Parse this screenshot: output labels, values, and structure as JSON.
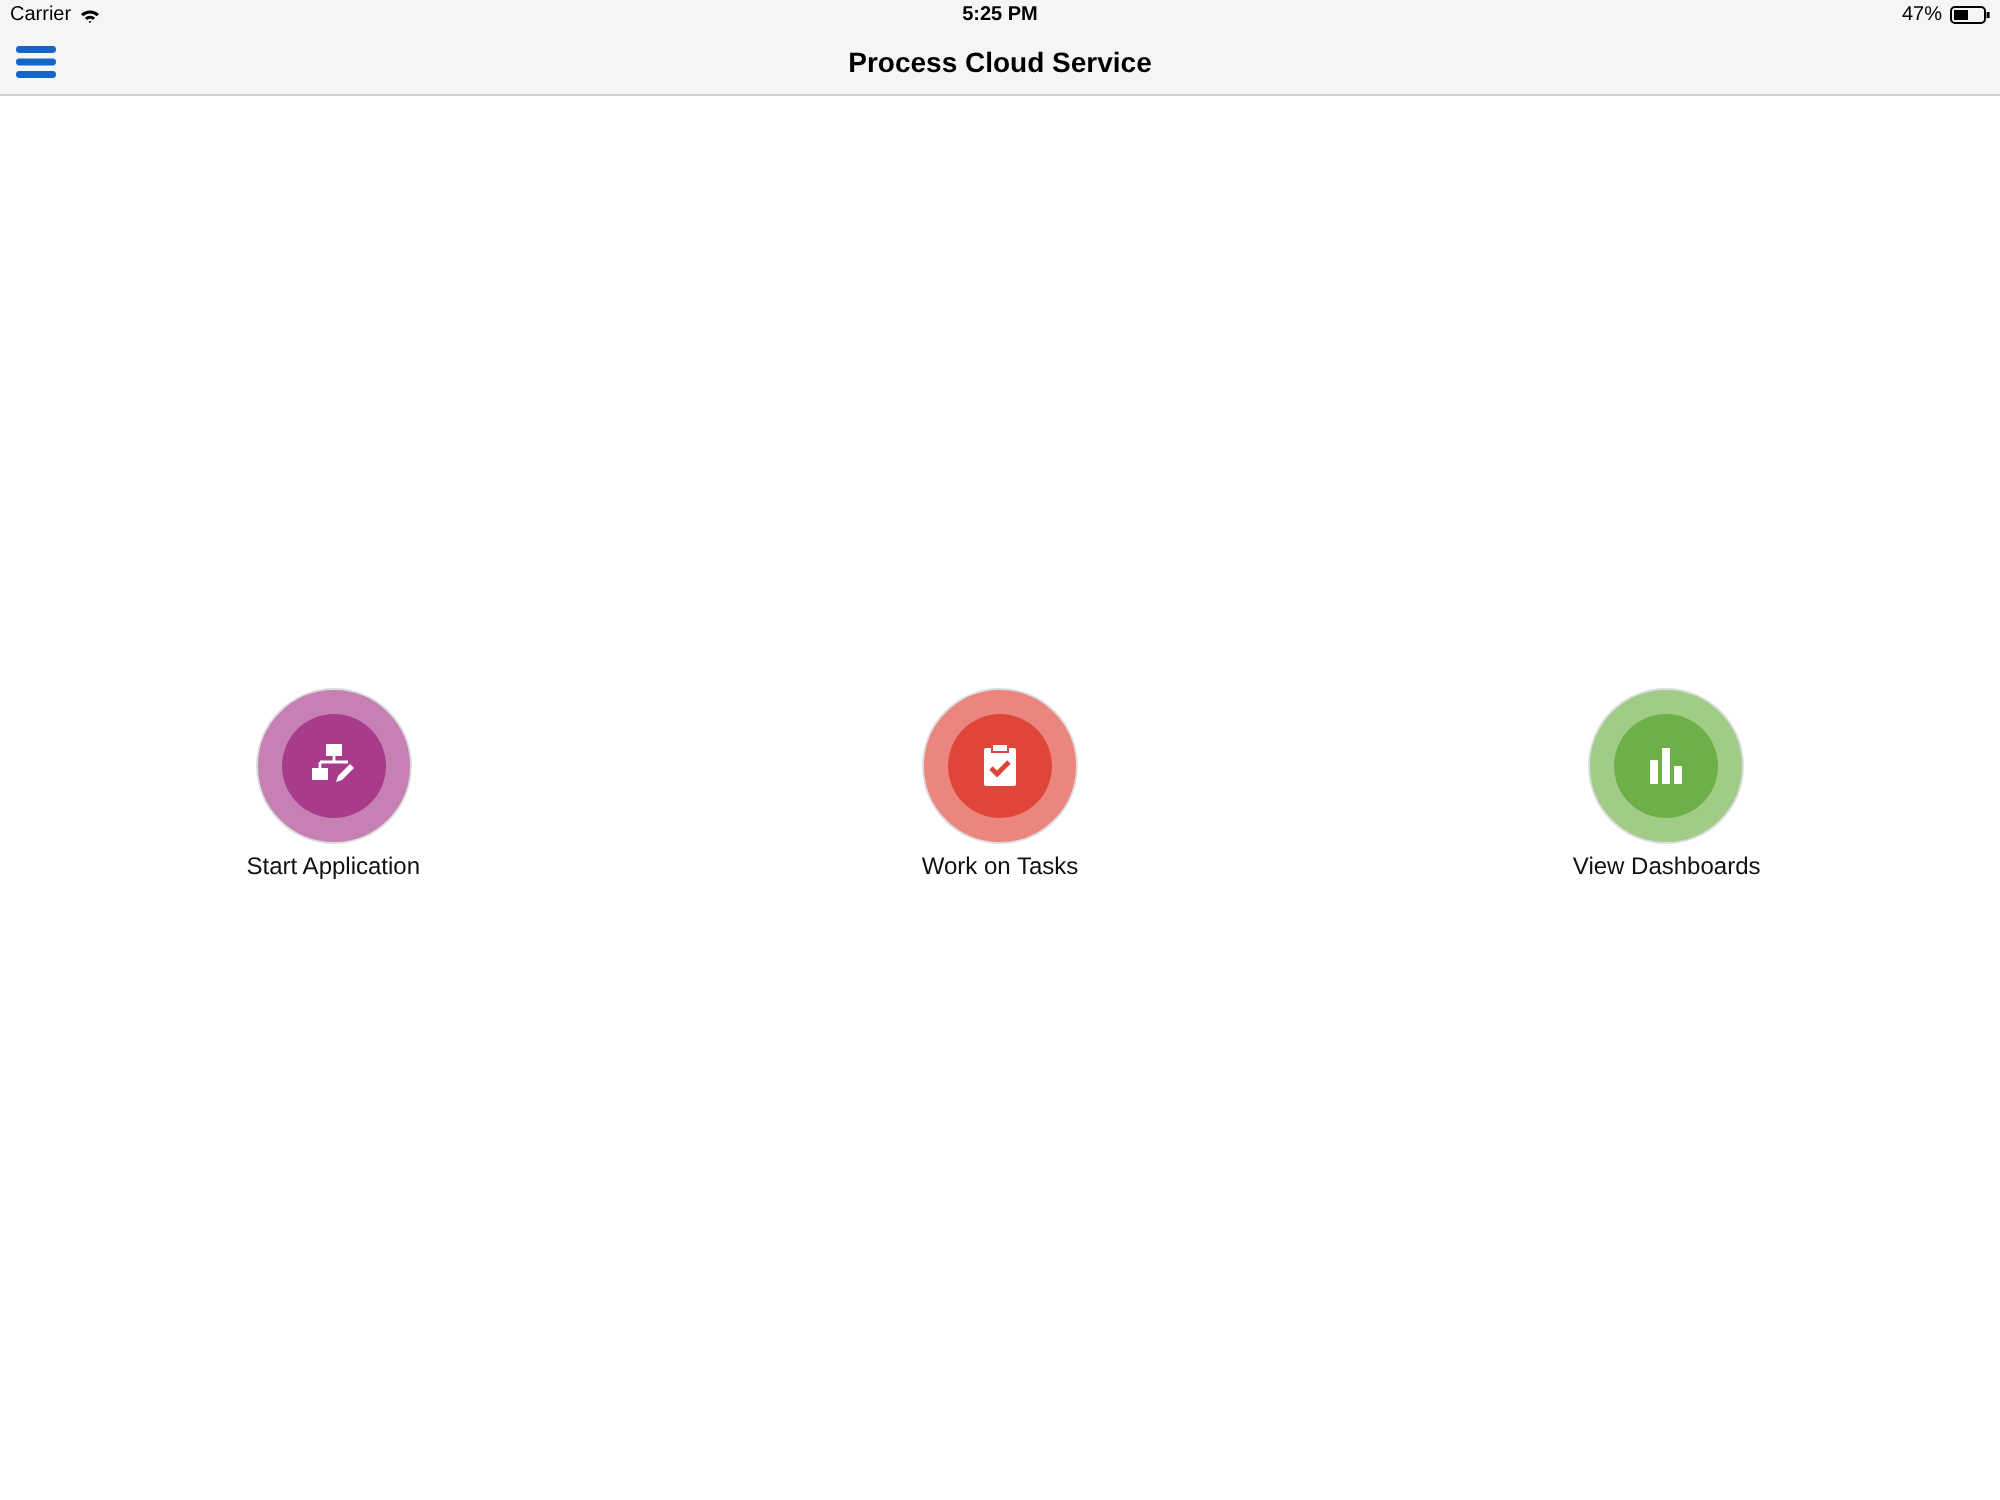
{
  "status_bar": {
    "carrier": "Carrier",
    "time": "5:25 PM",
    "battery": "47%"
  },
  "nav_bar": {
    "title": "Process Cloud Service"
  },
  "tiles": [
    {
      "label": "Start Application",
      "kind": "process",
      "color": "#a83b8c"
    },
    {
      "label": "Work on Tasks",
      "kind": "tasks",
      "color": "#e0453a"
    },
    {
      "label": "View Dashboards",
      "kind": "dashboards",
      "color": "#6db048"
    }
  ]
}
